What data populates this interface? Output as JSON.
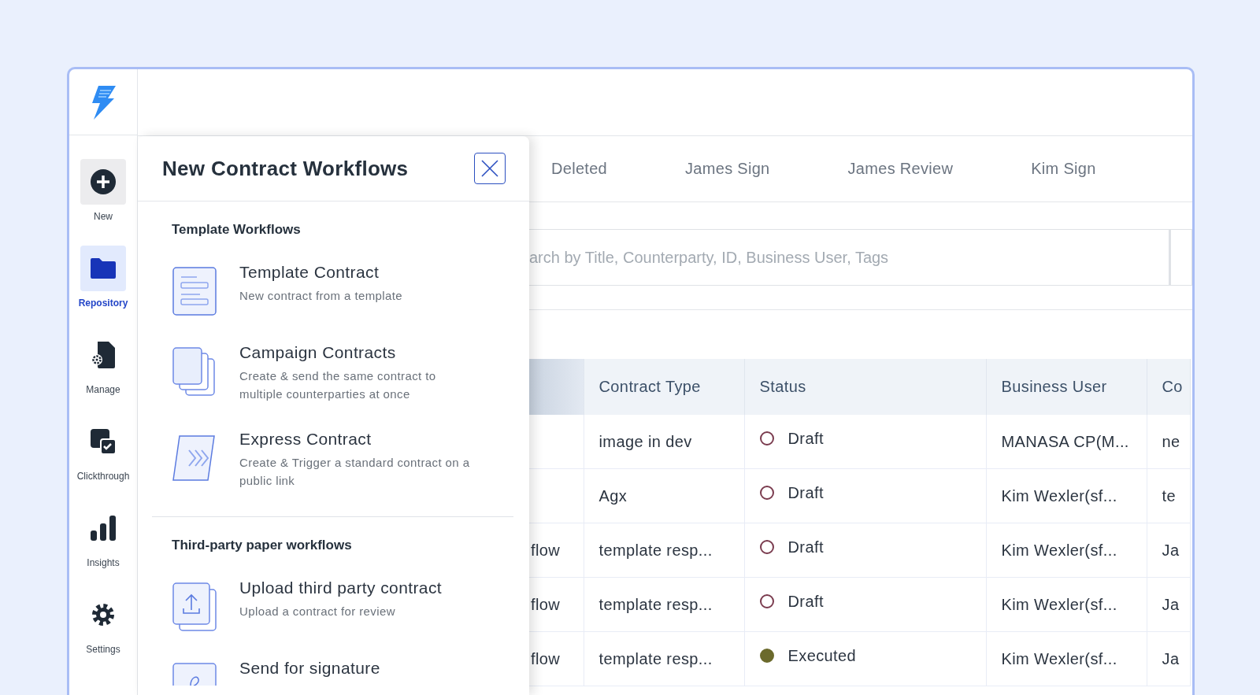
{
  "sidebar": {
    "items": [
      {
        "kind": "new",
        "label": "New",
        "selected": false
      },
      {
        "kind": "repository",
        "label": "Repository",
        "selected": true
      },
      {
        "kind": "manage",
        "label": "Manage",
        "selected": false
      },
      {
        "kind": "clickthrough",
        "label": "Clickthrough",
        "selected": false
      },
      {
        "kind": "insights",
        "label": "Insights",
        "selected": false
      },
      {
        "kind": "settings",
        "label": "Settings",
        "selected": false
      }
    ]
  },
  "panel": {
    "title": "New Contract Workflows",
    "sections": [
      {
        "title": "Template Workflows",
        "items": [
          {
            "kind": "template",
            "title": "Template Contract",
            "description": "New contract from a template"
          },
          {
            "kind": "campaign",
            "title": "Campaign Contracts",
            "description": "Create & send the same contract to multiple counterparties at once"
          },
          {
            "kind": "express",
            "title": "Express Contract",
            "description": "Create & Trigger a standard contract on a public link"
          }
        ]
      },
      {
        "title": "Third-party paper workflows",
        "items": [
          {
            "kind": "upload",
            "title": "Upload third party contract",
            "description": "Upload a contract for review"
          },
          {
            "kind": "signature",
            "title": "Send for signature"
          }
        ]
      }
    ]
  },
  "tabs": [
    {
      "label": "Deleted",
      "selected": false
    },
    {
      "label": "James Sign",
      "selected": false
    },
    {
      "label": "James Review",
      "selected": false
    },
    {
      "label": "Kim Sign",
      "selected": false
    }
  ],
  "search": {
    "placeholder": "arch by Title, Counterparty, ID, Business User, Tags"
  },
  "table": {
    "columns": [
      "",
      "Contract Type",
      "Status",
      "Business User",
      "Co"
    ],
    "rows": [
      {
        "column_1": "",
        "contract_type": "image in dev",
        "status": {
          "label": "Draft",
          "kind": "draft",
          "color": "#7a3b4e"
        },
        "business_user": "MANASA CP(M...",
        "column_5": "ne"
      },
      {
        "column_1": "",
        "contract_type": "Agx",
        "status": {
          "label": "Draft",
          "kind": "draft",
          "color": "#7a3b4e"
        },
        "business_user": "Kim Wexler(sf...",
        "column_5": "te"
      },
      {
        "column_1": "flow",
        "contract_type": "template resp...",
        "status": {
          "label": "Draft",
          "kind": "draft",
          "color": "#7a3b4e"
        },
        "business_user": "Kim Wexler(sf...",
        "column_5": "Ja"
      },
      {
        "column_1": "flow",
        "contract_type": "template resp...",
        "status": {
          "label": "Draft",
          "kind": "draft",
          "color": "#7a3b4e"
        },
        "business_user": "Kim Wexler(sf...",
        "column_5": "Ja"
      },
      {
        "column_1": "flow",
        "contract_type": "template resp...",
        "status": {
          "label": "Executed",
          "kind": "executed",
          "color": "#6b6a2c"
        },
        "business_user": "Kim Wexler(sf...",
        "column_5": "Ja"
      }
    ]
  }
}
